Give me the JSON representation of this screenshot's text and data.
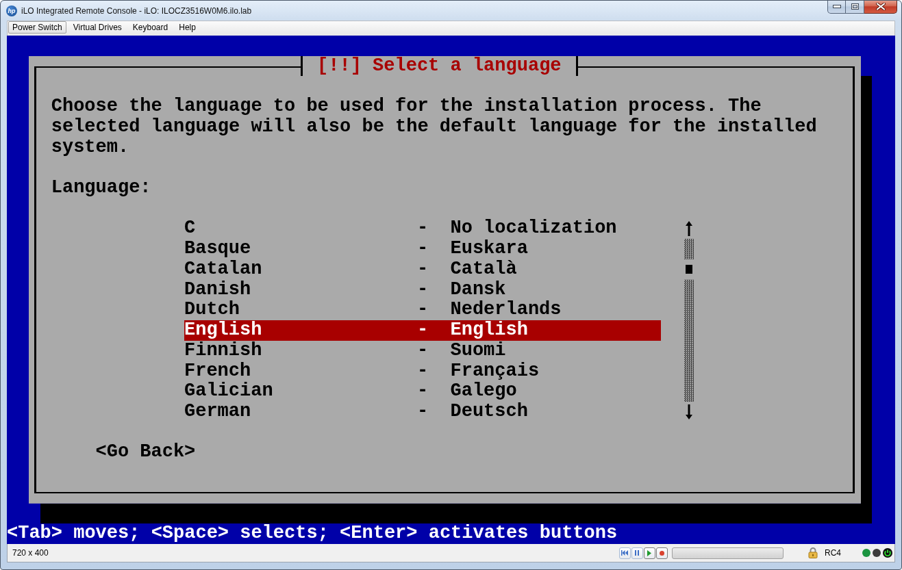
{
  "window": {
    "logo": "hp",
    "title": "iLO Integrated Remote Console - iLO: ILOCZ3516W0M6.ilo.lab"
  },
  "menu": [
    {
      "label": "Power Switch",
      "selected": true
    },
    {
      "label": "Virtual Drives",
      "selected": false
    },
    {
      "label": "Keyboard",
      "selected": false
    },
    {
      "label": "Help",
      "selected": false
    }
  ],
  "console": {
    "dialog": {
      "title": "[!!] Select a language",
      "message": "Choose the language to be used for the installation process. The selected language will also be the default language for the installed system.",
      "field_label": "Language:",
      "options": [
        {
          "name": "C",
          "separator": "-",
          "native": "No localization",
          "selected": false
        },
        {
          "name": "Basque",
          "separator": "-",
          "native": "Euskara",
          "selected": false
        },
        {
          "name": "Catalan",
          "separator": "-",
          "native": "Català",
          "selected": false
        },
        {
          "name": "Danish",
          "separator": "-",
          "native": "Dansk",
          "selected": false
        },
        {
          "name": "Dutch",
          "separator": "-",
          "native": "Nederlands",
          "selected": false
        },
        {
          "name": "English",
          "separator": "-",
          "native": "English",
          "selected": true
        },
        {
          "name": "Finnish",
          "separator": "-",
          "native": "Suomi",
          "selected": false
        },
        {
          "name": "French",
          "separator": "-",
          "native": "Français",
          "selected": false
        },
        {
          "name": "Galician",
          "separator": "-",
          "native": "Galego",
          "selected": false
        },
        {
          "name": "German",
          "separator": "-",
          "native": "Deutsch",
          "selected": false
        }
      ],
      "buttons": [
        "<Go Back>"
      ]
    },
    "help_line": "<Tab> moves; <Space> selects; <Enter> activates buttons"
  },
  "status_bar": {
    "resolution": "720 x 400",
    "playback": {
      "level": 0
    },
    "encryption": "RC4",
    "status_dots": [
      {
        "color": "#1b9440"
      },
      {
        "color": "#3c3c3c"
      }
    ]
  }
}
